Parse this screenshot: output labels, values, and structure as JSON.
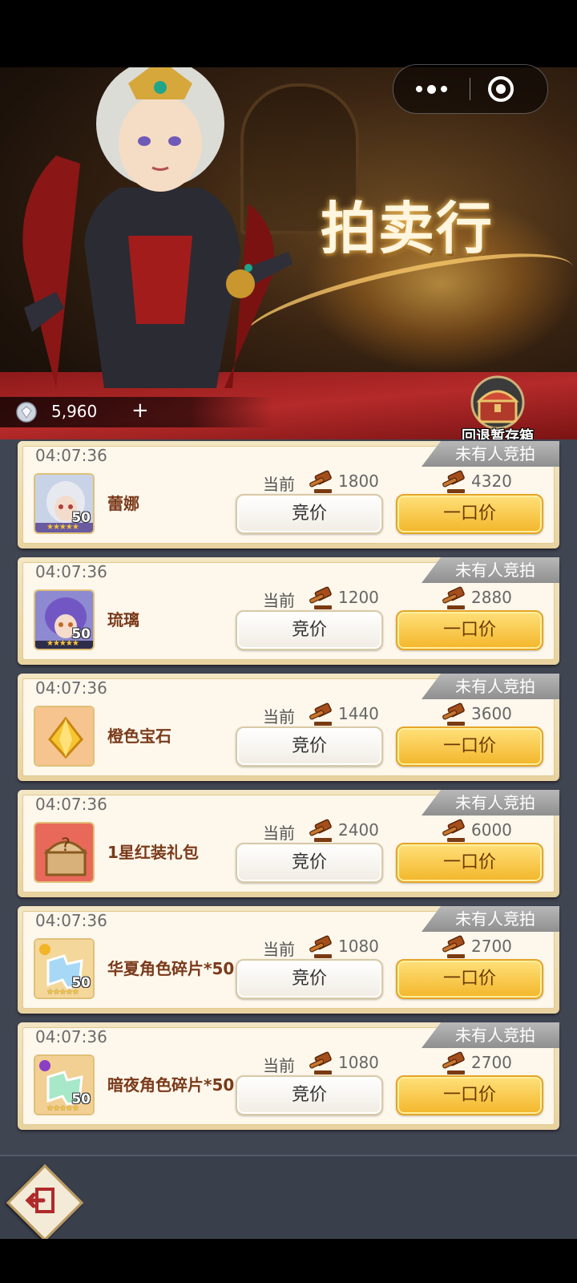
{
  "header": {
    "banner_title": "拍卖行",
    "chest_label": "回退暂存箱",
    "capsule": {
      "more_icon": "more-icon",
      "close_icon": "close-icon"
    }
  },
  "currency": {
    "icon": "diamond-icon",
    "amount": "5,960",
    "plus": "+"
  },
  "labels": {
    "current": "当前",
    "bid": "竞价",
    "buyout": "一口价"
  },
  "auctions": [
    {
      "timer": "04:07:36",
      "status": "未有人竞拍",
      "name": "蕾娜",
      "level": "50",
      "icon": "hero-portrait-icon",
      "current": "1800",
      "buyout": "4320"
    },
    {
      "timer": "04:07:36",
      "status": "未有人竞拍",
      "name": "琉璃",
      "level": "50",
      "icon": "hero-portrait-icon",
      "current": "1200",
      "buyout": "2880"
    },
    {
      "timer": "04:07:36",
      "status": "未有人竞拍",
      "name": "橙色宝石",
      "level": "",
      "icon": "orange-gem-icon",
      "current": "1440",
      "buyout": "3600"
    },
    {
      "timer": "04:07:36",
      "status": "未有人竞拍",
      "name": "1星红装礼包",
      "level": "",
      "icon": "treasure-chest-icon",
      "current": "2400",
      "buyout": "6000"
    },
    {
      "timer": "04:07:36",
      "status": "未有人竞拍",
      "name": "华夏角色碎片*50",
      "level": "50",
      "icon": "puzzle-fragment-icon",
      "current": "1080",
      "buyout": "2700"
    },
    {
      "timer": "04:07:36",
      "status": "未有人竞拍",
      "name": "暗夜角色碎片*50",
      "level": "50",
      "icon": "puzzle-fragment-icon",
      "current": "1080",
      "buyout": "2700"
    }
  ],
  "colors": {
    "buy_button": "#f3b62a",
    "card_bg": "#fdf7ec",
    "list_bg": "#404552",
    "carpet": "#b52a2a"
  }
}
